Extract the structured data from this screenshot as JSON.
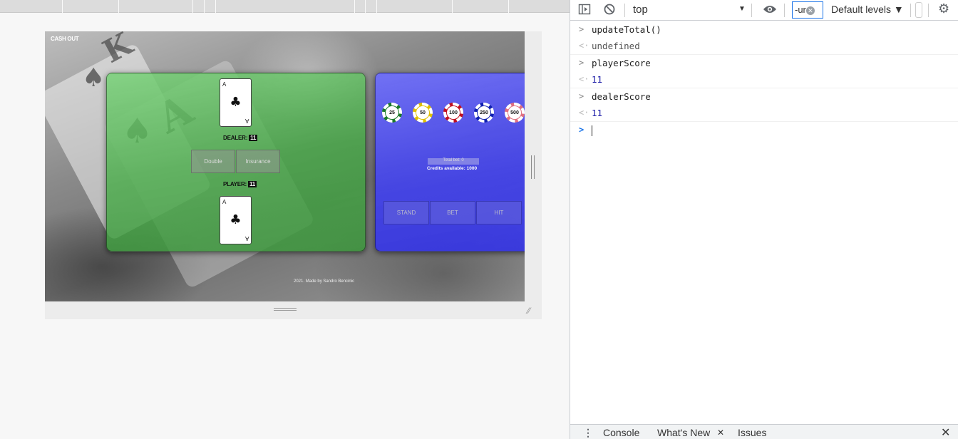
{
  "game": {
    "cash_out": "CASH OUT",
    "dealer_label": "DEALER:",
    "dealer_score": "11",
    "player_label": "PLAYER:",
    "player_score": "11",
    "double_label": "Double",
    "insurance_label": "Insurance",
    "dealer_card": {
      "rank": "A",
      "suit": "♣"
    },
    "player_card": {
      "rank": "A",
      "suit": "♣"
    },
    "chips": [
      {
        "value": "25",
        "color": "#1a7a2a"
      },
      {
        "value": "50",
        "color": "#e0c000"
      },
      {
        "value": "100",
        "color": "#c01020"
      },
      {
        "value": "250",
        "color": "#1020b0"
      },
      {
        "value": "500",
        "color": "#e07080"
      }
    ],
    "total_bet": "Total bet: 0",
    "credits": "Credits available: 1000",
    "stand_label": "STAND",
    "bet_label": "BET",
    "hit_label": "HIT",
    "footer": "2021. Made by Sandro Bencinic"
  },
  "devtools": {
    "context": "top",
    "filter_value": "-ur",
    "levels": "Default levels ▼",
    "console": [
      {
        "input": "updateTotal()",
        "output": "undefined",
        "type": "undef"
      },
      {
        "input": "playerScore",
        "output": "11",
        "type": "num"
      },
      {
        "input": "dealerScore",
        "output": "11",
        "type": "num"
      }
    ],
    "drawer_tabs": [
      "Console",
      "What's New",
      "Issues"
    ]
  }
}
